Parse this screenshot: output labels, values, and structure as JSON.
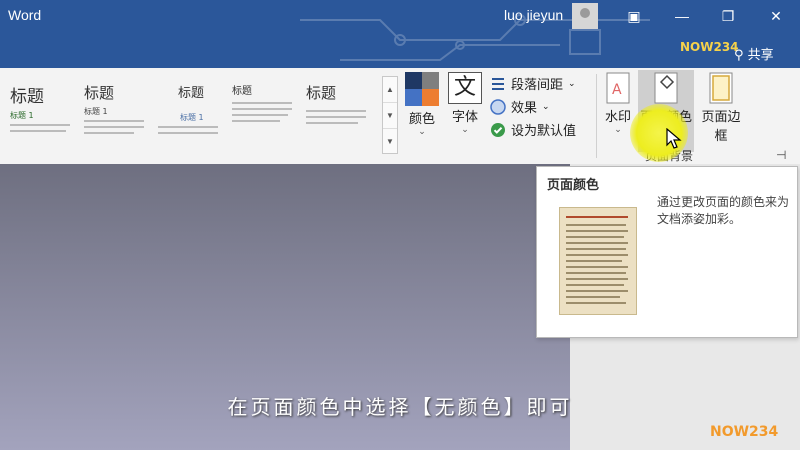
{
  "window": {
    "app_title": "Word",
    "user_name": "luo jieyun",
    "share_label": "共享",
    "logo_text": "NOW234",
    "minimize_glyph": "—",
    "restore_glyph": "❐",
    "close_glyph": "✕",
    "ribbon_display_glyph": "▣"
  },
  "ribbon": {
    "style_gallery": [
      {
        "title": "标题",
        "subtitle": "标题 1"
      },
      {
        "title": "标题",
        "subtitle": "标题 1"
      },
      {
        "title": "标题",
        "subtitle": "标题 1"
      },
      {
        "title": "标题",
        "subtitle": ""
      },
      {
        "title": "标题",
        "subtitle": ""
      }
    ],
    "colors_label": "颜色",
    "fonts_label": "字体",
    "fonts_glyph": "文",
    "paragraph_spacing_label": "段落间距",
    "effects_label": "效果",
    "set_default_label": "设为默认值",
    "watermark_label": "水印",
    "page_color_label": "页面颜色",
    "page_borders_label": "页面边框",
    "group_label": "页面背景",
    "caret": "⌄"
  },
  "tooltip": {
    "title": "页面颜色",
    "description": "通过更改页面的颜色来为文档添姿加彩。"
  },
  "subtitle": "在页面颜色中选择【无颜色】即可",
  "watermark_corner": "NOW234",
  "colors": {
    "titlebar": "#2b579a",
    "swatch": [
      "#1f3864",
      "#7f7f7f",
      "#4472c4",
      "#ed7d31"
    ],
    "accent_yellow": "#eded1f"
  }
}
